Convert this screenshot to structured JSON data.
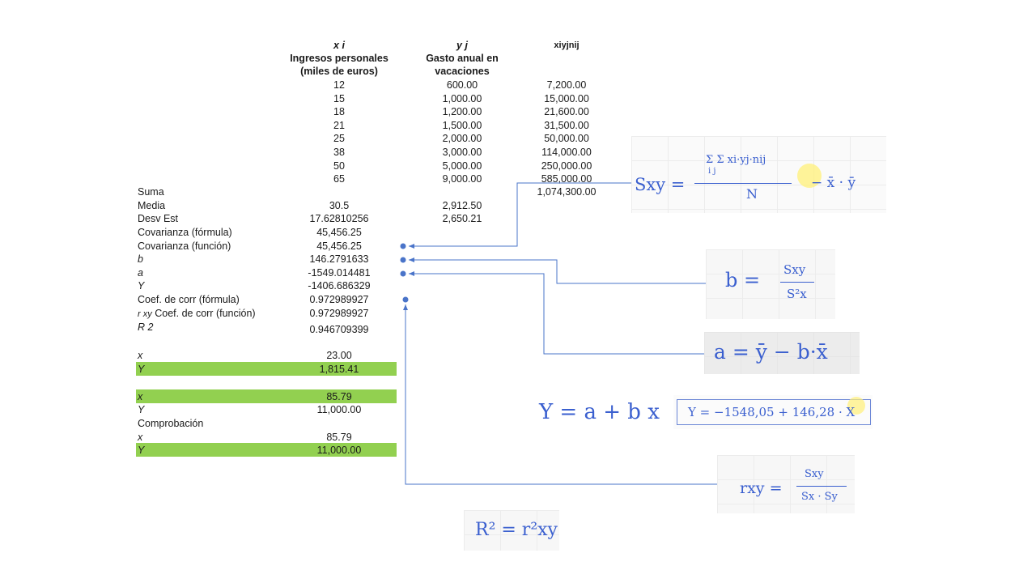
{
  "headers": {
    "x_sym": "x i",
    "x_desc1": "Ingresos personales",
    "x_desc2": "(miles de euros)",
    "y_sym": "y j",
    "y_desc1": "Gasto anual en",
    "y_desc2": "vacaciones",
    "xy_sym": "xiyjnij"
  },
  "rows": [
    {
      "x": "12",
      "y": "600.00",
      "xy": "7,200.00"
    },
    {
      "x": "15",
      "y": "1,000.00",
      "xy": "15,000.00"
    },
    {
      "x": "18",
      "y": "1,200.00",
      "xy": "21,600.00"
    },
    {
      "x": "21",
      "y": "1,500.00",
      "xy": "31,500.00"
    },
    {
      "x": "25",
      "y": "2,000.00",
      "xy": "50,000.00"
    },
    {
      "x": "38",
      "y": "3,000.00",
      "xy": "114,000.00"
    },
    {
      "x": "50",
      "y": "5,000.00",
      "xy": "250,000.00"
    },
    {
      "x": "65",
      "y": "9,000.00",
      "xy": "585,000.00"
    }
  ],
  "stats": {
    "suma_label": "Suma",
    "suma_xy": "1,074,300.00",
    "media_label": "Media",
    "media_x": "30.5",
    "media_y": "2,912.50",
    "desv_label": "Desv Est",
    "desv_x": "17.62810256",
    "desv_y": "2,650.21",
    "cov_f_label": "Covarianza (fórmula)",
    "cov_f": "45,456.25",
    "cov_fn_label": "Covarianza (función)",
    "cov_fn": "45,456.25",
    "b_label": "b",
    "b": "146.2791633",
    "a_label": "a",
    "a": "-1549.014481",
    "Y_label": "Y",
    "Y": "-1406.686329",
    "corr_f_label": "Coef. de corr (fórmula)",
    "corr_f": "0.972989927",
    "corr_fn_sym": "r xy",
    "corr_fn_label": "Coef. de corr (función)",
    "corr_fn": "0.972989927",
    "r2_label": "R 2",
    "r2": "0.946709399"
  },
  "pred": {
    "x1_label": "x",
    "x1": "23.00",
    "Y1_label": "Y",
    "Y1": "1,815.41",
    "x2_label": "x",
    "x2": "85.79",
    "Y2_label": "Y",
    "Y2": "11,000.00",
    "check_label": "Comprobación",
    "x3_label": "x",
    "x3": "85.79",
    "Y3_label": "Y",
    "Y3": "11,000.00"
  },
  "colors": {
    "green": "#92d050",
    "connector": "#4a74c9",
    "ink": "#3a5fcf"
  },
  "formulas": {
    "sxy_lhs": "Sxy =",
    "sxy_num": "Σ Σ xi·yj·nij",
    "sxy_idx": "i  j",
    "sxy_den": "N",
    "sxy_tail": "− x̄ · ȳ",
    "b_lhs": "b =",
    "b_num": "Sxy",
    "b_den": "S²x",
    "a_eq": "a = ȳ − b·x̄",
    "y_eq": "Y = a + b x",
    "y_box": "Y = −1548,05 + 146,28 · X",
    "r_lhs": "rxy =",
    "r_num": "Sxy",
    "r_den": "Sx · Sy",
    "r2_eq": "R² = r²xy"
  }
}
